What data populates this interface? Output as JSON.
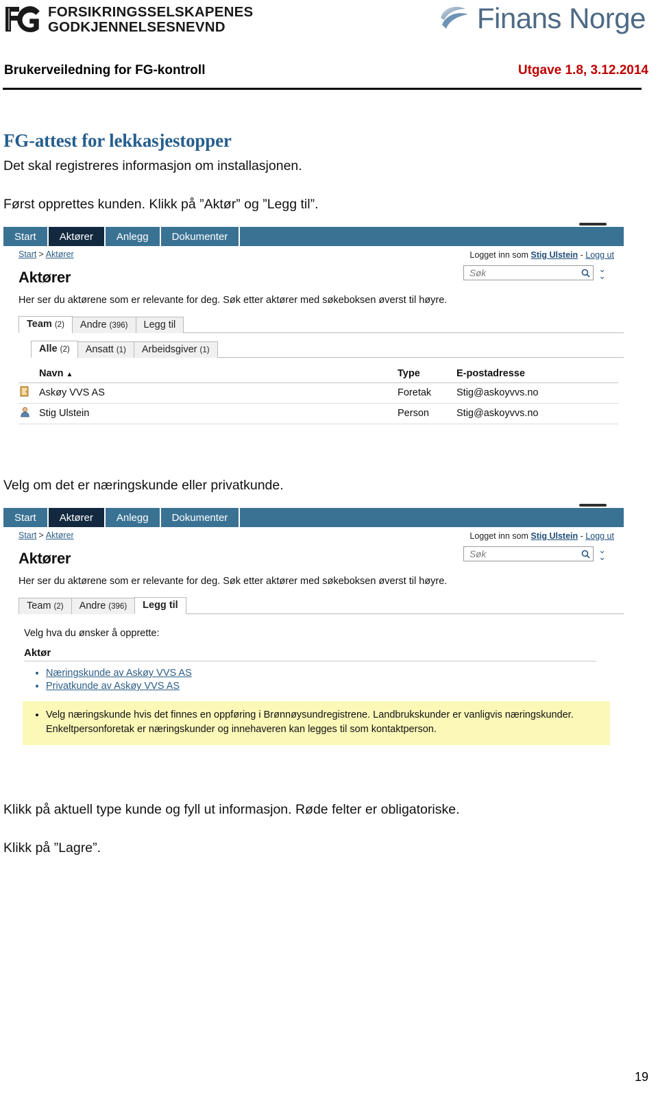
{
  "header": {
    "fg_logo_text": "FORSIKRINGSSELSKAPENES\nGODKJENNELSESNEVND",
    "fg_logo_mark": "FG",
    "finans_norge_text": "Finans Norge",
    "doc_title": "Brukerveiledning for FG-kontroll",
    "edition": "Utgave 1.8, 3.12.2014"
  },
  "doc": {
    "section_title": "FG-attest for lekkasjestopper",
    "para1": "Det skal registreres informasjon om installasjonen.",
    "para2": "Først opprettes kunden. Klikk på ”Aktør” og ”Legg til”.",
    "para3": "Velg om det er næringskunde eller privatkunde.",
    "para4": "Klikk på aktuell type kunde og fyll ut informasjon. Røde felter er obligatoriske.",
    "para5": "Klikk på ”Lagre”.",
    "page_number": "19"
  },
  "screenshot1": {
    "nav_tabs": [
      {
        "label": "Start",
        "active": false
      },
      {
        "label": "Aktører",
        "active": true
      },
      {
        "label": "Anlegg",
        "active": false
      },
      {
        "label": "Dokumenter",
        "active": false
      }
    ],
    "breadcrumb": {
      "first": "Start",
      "sep": ">",
      "second": "Aktører"
    },
    "login": {
      "prefix": "Logget inn som",
      "user": "Stig Ulstein",
      "dash": "-",
      "logout": "Logg ut"
    },
    "search": {
      "placeholder": "Søk",
      "icon": "search-icon",
      "expand_icon": "chevron-double-down-icon"
    },
    "page_heading": "Aktører",
    "intro": "Her ser du aktørene som er relevante for deg. Søk etter aktører med søkeboksen øverst til høyre.",
    "tabs_primary": [
      {
        "label": "Team",
        "count": "(2)",
        "selected": true
      },
      {
        "label": "Andre",
        "count": "(396)",
        "selected": false
      },
      {
        "label": "Legg til",
        "count": "",
        "selected": false
      }
    ],
    "tabs_secondary": [
      {
        "label": "Alle",
        "count": "(2)",
        "selected": true
      },
      {
        "label": "Ansatt",
        "count": "(1)",
        "selected": false
      },
      {
        "label": "Arbeidsgiver",
        "count": "(1)",
        "selected": false
      }
    ],
    "table": {
      "columns": [
        "Navn",
        "Type",
        "E-postadresse"
      ],
      "sort_column": "Navn",
      "sort_caret": "▲",
      "rows": [
        {
          "icon": "building-icon",
          "navn": "Askøy VVS AS",
          "type": "Foretak",
          "epost": "Stig@askoyvvs.no"
        },
        {
          "icon": "person-icon",
          "navn": "Stig Ulstein",
          "type": "Person",
          "epost": "Stig@askoyvvs.no"
        }
      ]
    }
  },
  "screenshot2": {
    "nav_tabs": [
      {
        "label": "Start",
        "active": false
      },
      {
        "label": "Aktører",
        "active": true
      },
      {
        "label": "Anlegg",
        "active": false
      },
      {
        "label": "Dokumenter",
        "active": false
      }
    ],
    "breadcrumb": {
      "first": "Start",
      "sep": ">",
      "second": "Aktører"
    },
    "login": {
      "prefix": "Logget inn som",
      "user": "Stig Ulstein",
      "dash": "-",
      "logout": "Logg ut"
    },
    "search": {
      "placeholder": "Søk",
      "icon": "search-icon",
      "expand_icon": "chevron-double-down-icon"
    },
    "page_heading": "Aktører",
    "intro": "Her ser du aktørene som er relevante for deg. Søk etter aktører med søkeboksen øverst til høyre.",
    "tabs_primary": [
      {
        "label": "Team",
        "count": "(2)",
        "selected": false
      },
      {
        "label": "Andre",
        "count": "(396)",
        "selected": false
      },
      {
        "label": "Legg til",
        "count": "",
        "selected": true
      }
    ],
    "choose_label": "Velg hva du ønsker å opprette:",
    "choose_group": "Aktør",
    "choose_links": [
      "Næringskunde av Askøy VVS AS",
      "Privatkunde av Askøy VVS AS"
    ],
    "note": "Velg næringskunde hvis det finnes en oppføring i Brønnøysundregistrene. Landbrukskunder er vanligvis næringskunder. Enkeltpersonforetak er næringskunder og innehaveren kan legges til som kontaktperson."
  },
  "colors": {
    "nav_blue": "#3a7294",
    "nav_active": "#12293f",
    "heading_blue": "#255e8e",
    "edition_red": "#c00000",
    "note_yellow": "#fbf8b8",
    "link_blue": "#2c5d86",
    "finans_norge_blue": "#4d6a86"
  }
}
